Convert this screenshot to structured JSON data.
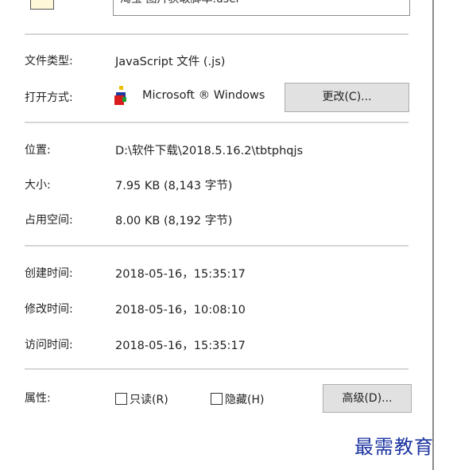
{
  "header": {
    "name_value": "淘宝 图片获取脚本.user"
  },
  "general": {
    "file_type_label": "文件类型:",
    "file_type_value": "JavaScript 文件 (.js)",
    "opens_with_label": "打开方式:",
    "opens_with_value": "Microsoft ® Windows",
    "opens_with_icon": "windows-script-host-icon",
    "change_button": "更改(C)...",
    "location_label": "位置:",
    "location_value": "D:\\软件下载\\2018.5.16.2\\tbtphqjs",
    "size_label": "大小:",
    "size_value": "7.95 KB (8,143 字节)",
    "size_on_disk_label": "占用空间:",
    "size_on_disk_value": "8.00 KB (8,192 字节)"
  },
  "times": {
    "created_label": "创建时间:",
    "created_value": "2018-05-16，15:35:17",
    "modified_label": "修改时间:",
    "modified_value": "2018-05-16，10:08:10",
    "accessed_label": "访问时间:",
    "accessed_value": "2018-05-16，15:35:17"
  },
  "attributes": {
    "label": "属性:",
    "readonly_label": "只读(R)",
    "readonly_checked": false,
    "hidden_label": "隐藏(H)",
    "hidden_checked": false,
    "advanced_button": "高级(D)..."
  },
  "watermark": {
    "text": "最需教育",
    "color": "#1d34a0"
  },
  "colors": {
    "button_bg": "#e1e1e1",
    "separator": "#d6d6d6"
  }
}
